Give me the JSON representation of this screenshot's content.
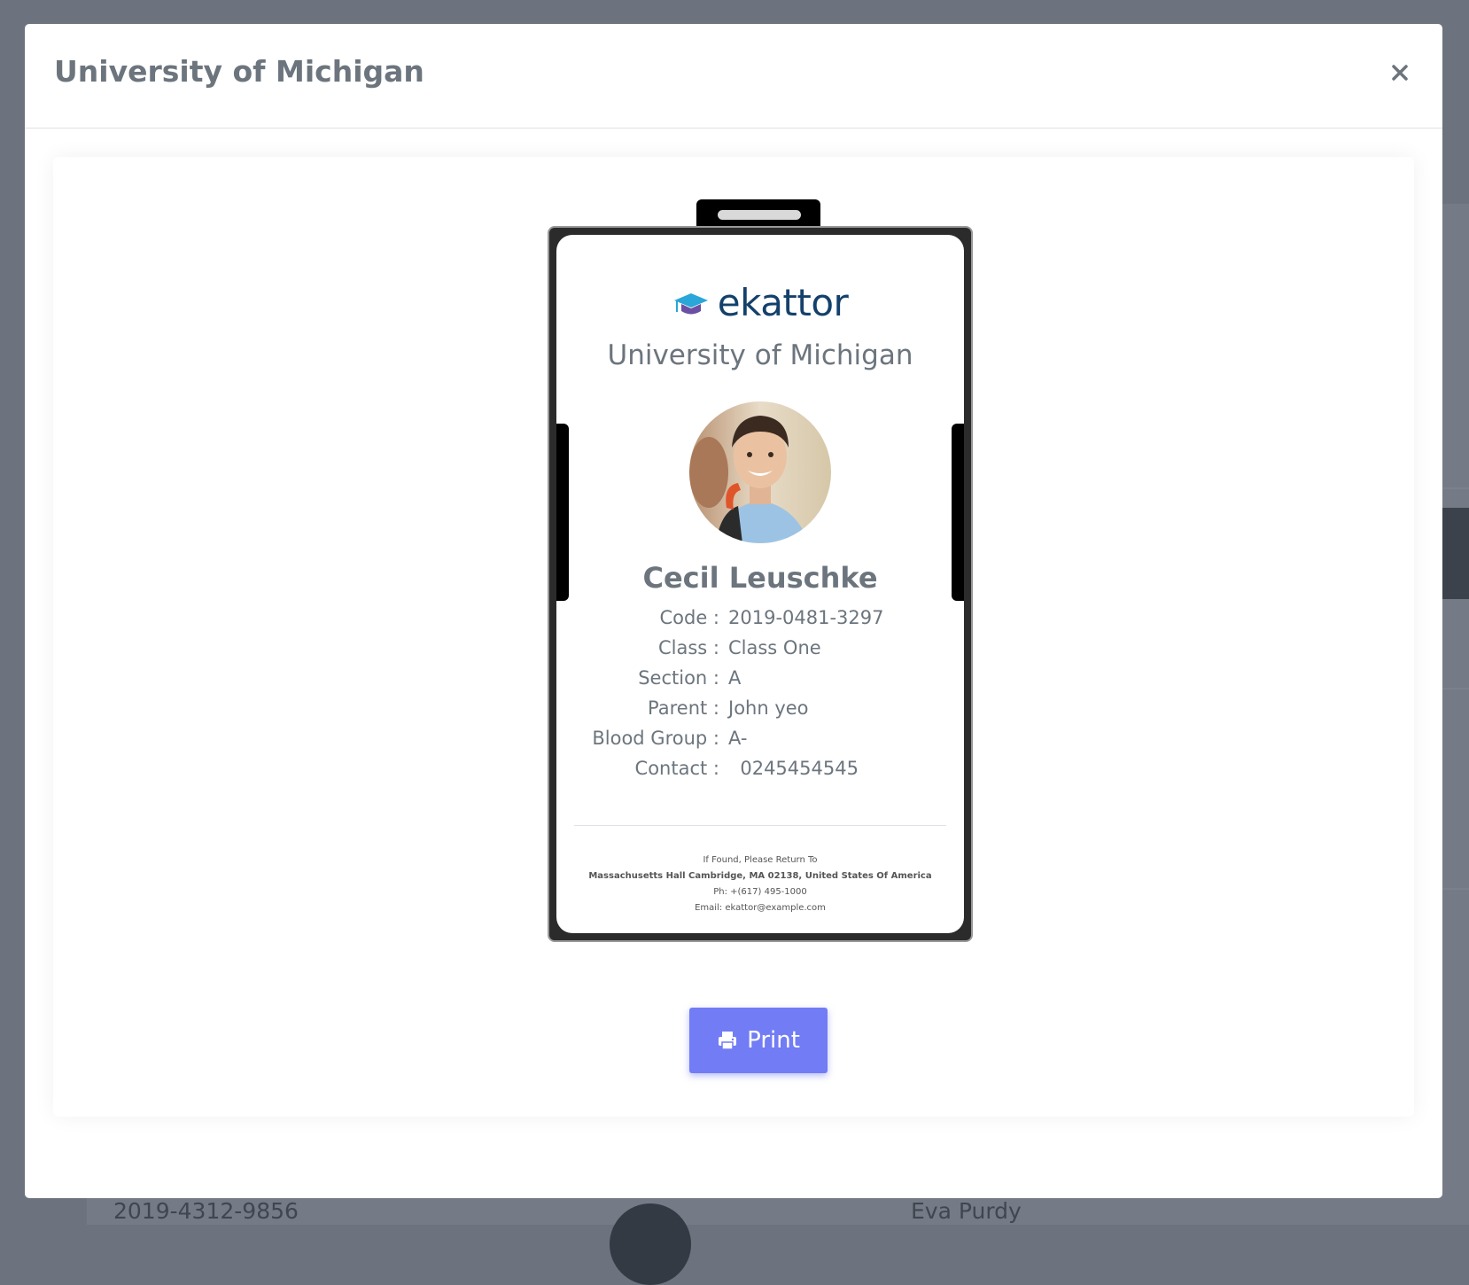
{
  "background": {
    "row_code": "2019-4312-9856",
    "row_name": "Eva Purdy"
  },
  "modal": {
    "title": "University of Michigan",
    "close_label": "×"
  },
  "id_card": {
    "logo_text": "ekattor",
    "school_name": "University of Michigan",
    "student_name": "Cecil Leuschke",
    "details": [
      {
        "label": "Code :",
        "value": "2019-0481-3297"
      },
      {
        "label": "Class :",
        "value": "Class One"
      },
      {
        "label": "Section :",
        "value": "A"
      },
      {
        "label": "Parent :",
        "value": "John yeo"
      },
      {
        "label": "Blood Group :",
        "value": "A-"
      },
      {
        "label": "Contact :",
        "value": "  0245454545"
      }
    ],
    "footer": {
      "line1": "If Found, Please Return To",
      "line2": "Massachusetts Hall Cambridge, MA 02138, United States Of America",
      "line3": "Ph: +(617) 495-1000",
      "line4": "Email: ekattor@example.com"
    }
  },
  "print_button": {
    "label": "Print"
  },
  "colors": {
    "primary": "#727cf5",
    "logo": "#14416b",
    "text": "#6c757d",
    "overlay": "#6c737e"
  }
}
